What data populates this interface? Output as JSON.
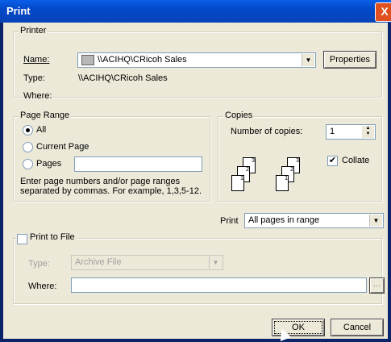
{
  "window": {
    "title": "Print",
    "close_glyph": "X"
  },
  "printer": {
    "group_label": "Printer",
    "name_label": "Name:",
    "name_value": "\\\\ACIHQ\\CRicoh Sales",
    "properties_label": "Properties",
    "type_label": "Type:",
    "type_value": "\\\\ACIHQ\\CRicoh Sales",
    "where_label": "Where:"
  },
  "page_range": {
    "group_label": "Page Range",
    "all_label": "All",
    "current_label": "Current Page",
    "pages_label": "Pages",
    "pages_value": "",
    "hint": "Enter page numbers and/or page ranges separated by commas.  For example, 1,3,5-12."
  },
  "copies": {
    "group_label": "Copies",
    "number_label": "Number of copies:",
    "number_value": "1",
    "collate_label": "Collate",
    "collate_checked": true,
    "page_numbers": [
      "1",
      "2",
      "3"
    ]
  },
  "print_select": {
    "label": "Print",
    "value": "All pages in range"
  },
  "print_to_file": {
    "group_label": "Print to File",
    "type_label": "Type:",
    "type_value": "Archive File",
    "where_label": "Where:",
    "where_value": "",
    "browse_label": "..."
  },
  "buttons": {
    "ok": "OK",
    "cancel": "Cancel"
  }
}
